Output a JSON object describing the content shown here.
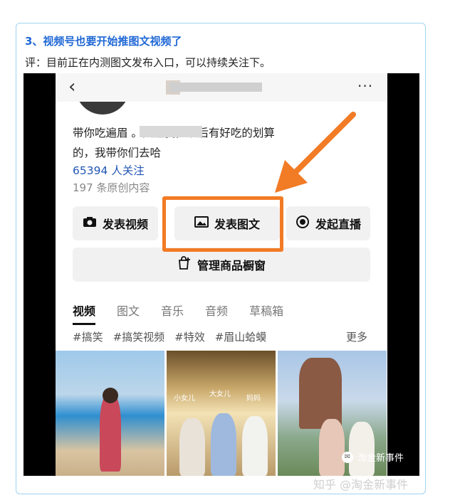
{
  "article": {
    "heading": "3、视频号也要开始推图文视频了",
    "comment": "评：目前正在内测图文发布入口，可以持续关注下。"
  },
  "profile": {
    "bio_line1": "带你吃遍眉          。关注我，以后有好吃的划算",
    "bio_line2": "的，我带你们去哈",
    "followers": "65394 人关注",
    "original_count": "197 条原创内容",
    "more_icon": "···",
    "back_icon": "‹"
  },
  "actions": {
    "post_video": "发表视频",
    "post_image_text": "发表图文",
    "start_live": "发起直播",
    "manage_shop": "管理商品橱窗"
  },
  "tabs": [
    "视频",
    "图文",
    "音乐",
    "音频",
    "草稿箱"
  ],
  "hashtags": [
    "#搞笑",
    "#搞笑视频",
    "#特效",
    "#眉山蛤蟆"
  ],
  "more_tags": "更多",
  "thumb_labels": [
    "小女儿",
    "大女儿",
    "妈妈"
  ],
  "watermarks": {
    "inner": "淘金新事件",
    "outer": "知乎 @淘金新事件"
  },
  "colors": {
    "accent_orange": "#f27b25",
    "heading_blue": "#1f67d6",
    "link_blue": "#2155b5"
  }
}
